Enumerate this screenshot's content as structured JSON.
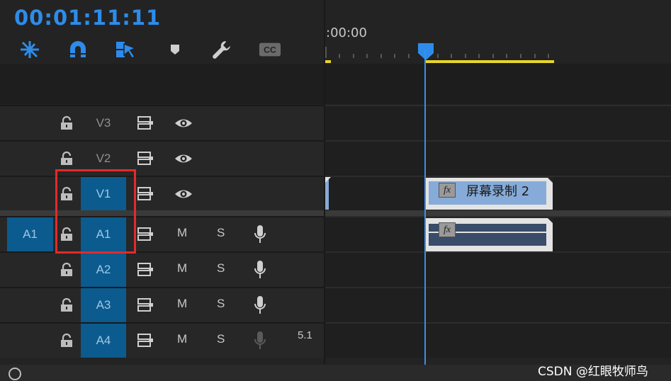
{
  "header": {
    "timecode": "00:01:11:11",
    "ruler_time": ":00:00",
    "tools": [
      "snap-settings-icon",
      "magnet-icon",
      "linked-selection-icon",
      "marker-icon",
      "wrench-icon",
      "captions-icon"
    ],
    "captions_label": "CC"
  },
  "tracks": {
    "video": [
      {
        "name": "V3",
        "targeted": false
      },
      {
        "name": "V2",
        "targeted": false
      },
      {
        "name": "V1",
        "targeted": true
      }
    ],
    "audio": [
      {
        "name": "A1",
        "targeted": true,
        "source": "A1"
      },
      {
        "name": "A2",
        "targeted": true
      },
      {
        "name": "A3",
        "targeted": true
      },
      {
        "name": "A4",
        "targeted": true,
        "channel": "5.1"
      }
    ],
    "mute_label": "M",
    "solo_label": "S"
  },
  "clips": {
    "video_title": "屏幕录制 2",
    "fx_label": "fx"
  },
  "watermark": "CSDN @红眼牧师鸟",
  "colors": {
    "accent": "#2d8ceb",
    "target": "#0b5b8e",
    "video_clip": "#86abd8",
    "audio_clip": "#394c69",
    "inout": "#e8d52a",
    "highlight": "#e12b2b"
  }
}
